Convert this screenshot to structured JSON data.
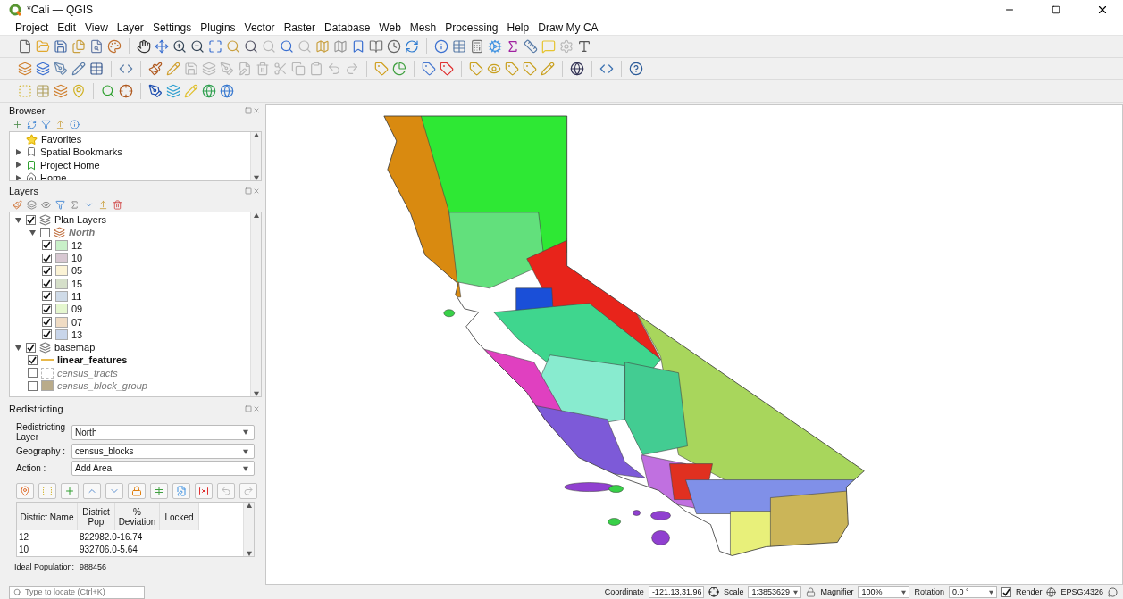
{
  "window": {
    "title": "*Cali — QGIS"
  },
  "menu": [
    "Project",
    "Edit",
    "View",
    "Layer",
    "Settings",
    "Plugins",
    "Vector",
    "Raster",
    "Database",
    "Web",
    "Mesh",
    "Processing",
    "Help",
    "Draw My CA"
  ],
  "browser": {
    "title": "Browser",
    "items": [
      {
        "label": "Favorites",
        "expandable": false
      },
      {
        "label": "Spatial Bookmarks",
        "expandable": true
      },
      {
        "label": "Project Home",
        "expandable": true
      },
      {
        "label": "Home",
        "expandable": true
      }
    ]
  },
  "layers": {
    "title": "Layers",
    "tree": [
      {
        "label": "Plan Layers",
        "checked": true,
        "expanded": true,
        "children": [
          {
            "label": "North",
            "checked": false,
            "expanded": true,
            "bold": true,
            "children": [
              {
                "label": "12",
                "checked": true,
                "kind": "fill",
                "color": "#c8f0c8"
              },
              {
                "label": "10",
                "checked": true,
                "kind": "fill",
                "color": "#d8c8d2"
              },
              {
                "label": "05",
                "checked": true,
                "kind": "fill",
                "color": "#fbf3d5"
              },
              {
                "label": "15",
                "checked": true,
                "kind": "fill",
                "color": "#d5dfc9"
              },
              {
                "label": "11",
                "checked": true,
                "kind": "fill",
                "color": "#cfdbe8"
              },
              {
                "label": "09",
                "checked": true,
                "kind": "fill",
                "color": "#e5f7cf"
              },
              {
                "label": "07",
                "checked": true,
                "kind": "fill",
                "color": "#f0dcc4"
              },
              {
                "label": "13",
                "checked": true,
                "kind": "fill",
                "color": "#c8d5ea"
              }
            ]
          }
        ]
      },
      {
        "label": "basemap",
        "checked": true,
        "expanded": true,
        "children": [
          {
            "label": "linear_features",
            "checked": true,
            "bold": true,
            "kind": "line",
            "color": "#e8b84a"
          },
          {
            "label": "census_tracts",
            "checked": false,
            "bold": false,
            "kind": "outline",
            "color": "#ffffff"
          },
          {
            "label": "census_block_group",
            "checked": false,
            "bold": false,
            "kind": "fill",
            "color": "#b9ab8a"
          }
        ]
      }
    ]
  },
  "redistricting": {
    "title": "Redistricting",
    "fields": [
      {
        "label": "Redistricting Layer",
        "value": "North"
      },
      {
        "label": "Geography :",
        "value": "census_blocks"
      },
      {
        "label": "Action :",
        "value": "Add Area"
      }
    ],
    "columns": [
      "District Name",
      "District Pop",
      "% Deviation",
      "Locked"
    ],
    "rows": [
      {
        "name": "12",
        "pop": "822982.0",
        "deviation": "-16.74"
      },
      {
        "name": "10",
        "pop": "932706.0",
        "deviation": "-5.64"
      }
    ],
    "ideal_label": "Ideal Population:",
    "ideal_value": "988456"
  },
  "status_bar": {
    "locate_placeholder": "Type to locate (Ctrl+K)",
    "coordinate_label": "Coordinate",
    "coordinate": "-121.13,31.96",
    "scale_label": "Scale",
    "scale": "1:3853629",
    "magnifier_label": "Magnifier",
    "magnifier": "100%",
    "rotation_label": "Rotation",
    "rotation": "0.0 °",
    "render_label": "Render",
    "render_checked": true,
    "crs": "EPSG:4326"
  }
}
